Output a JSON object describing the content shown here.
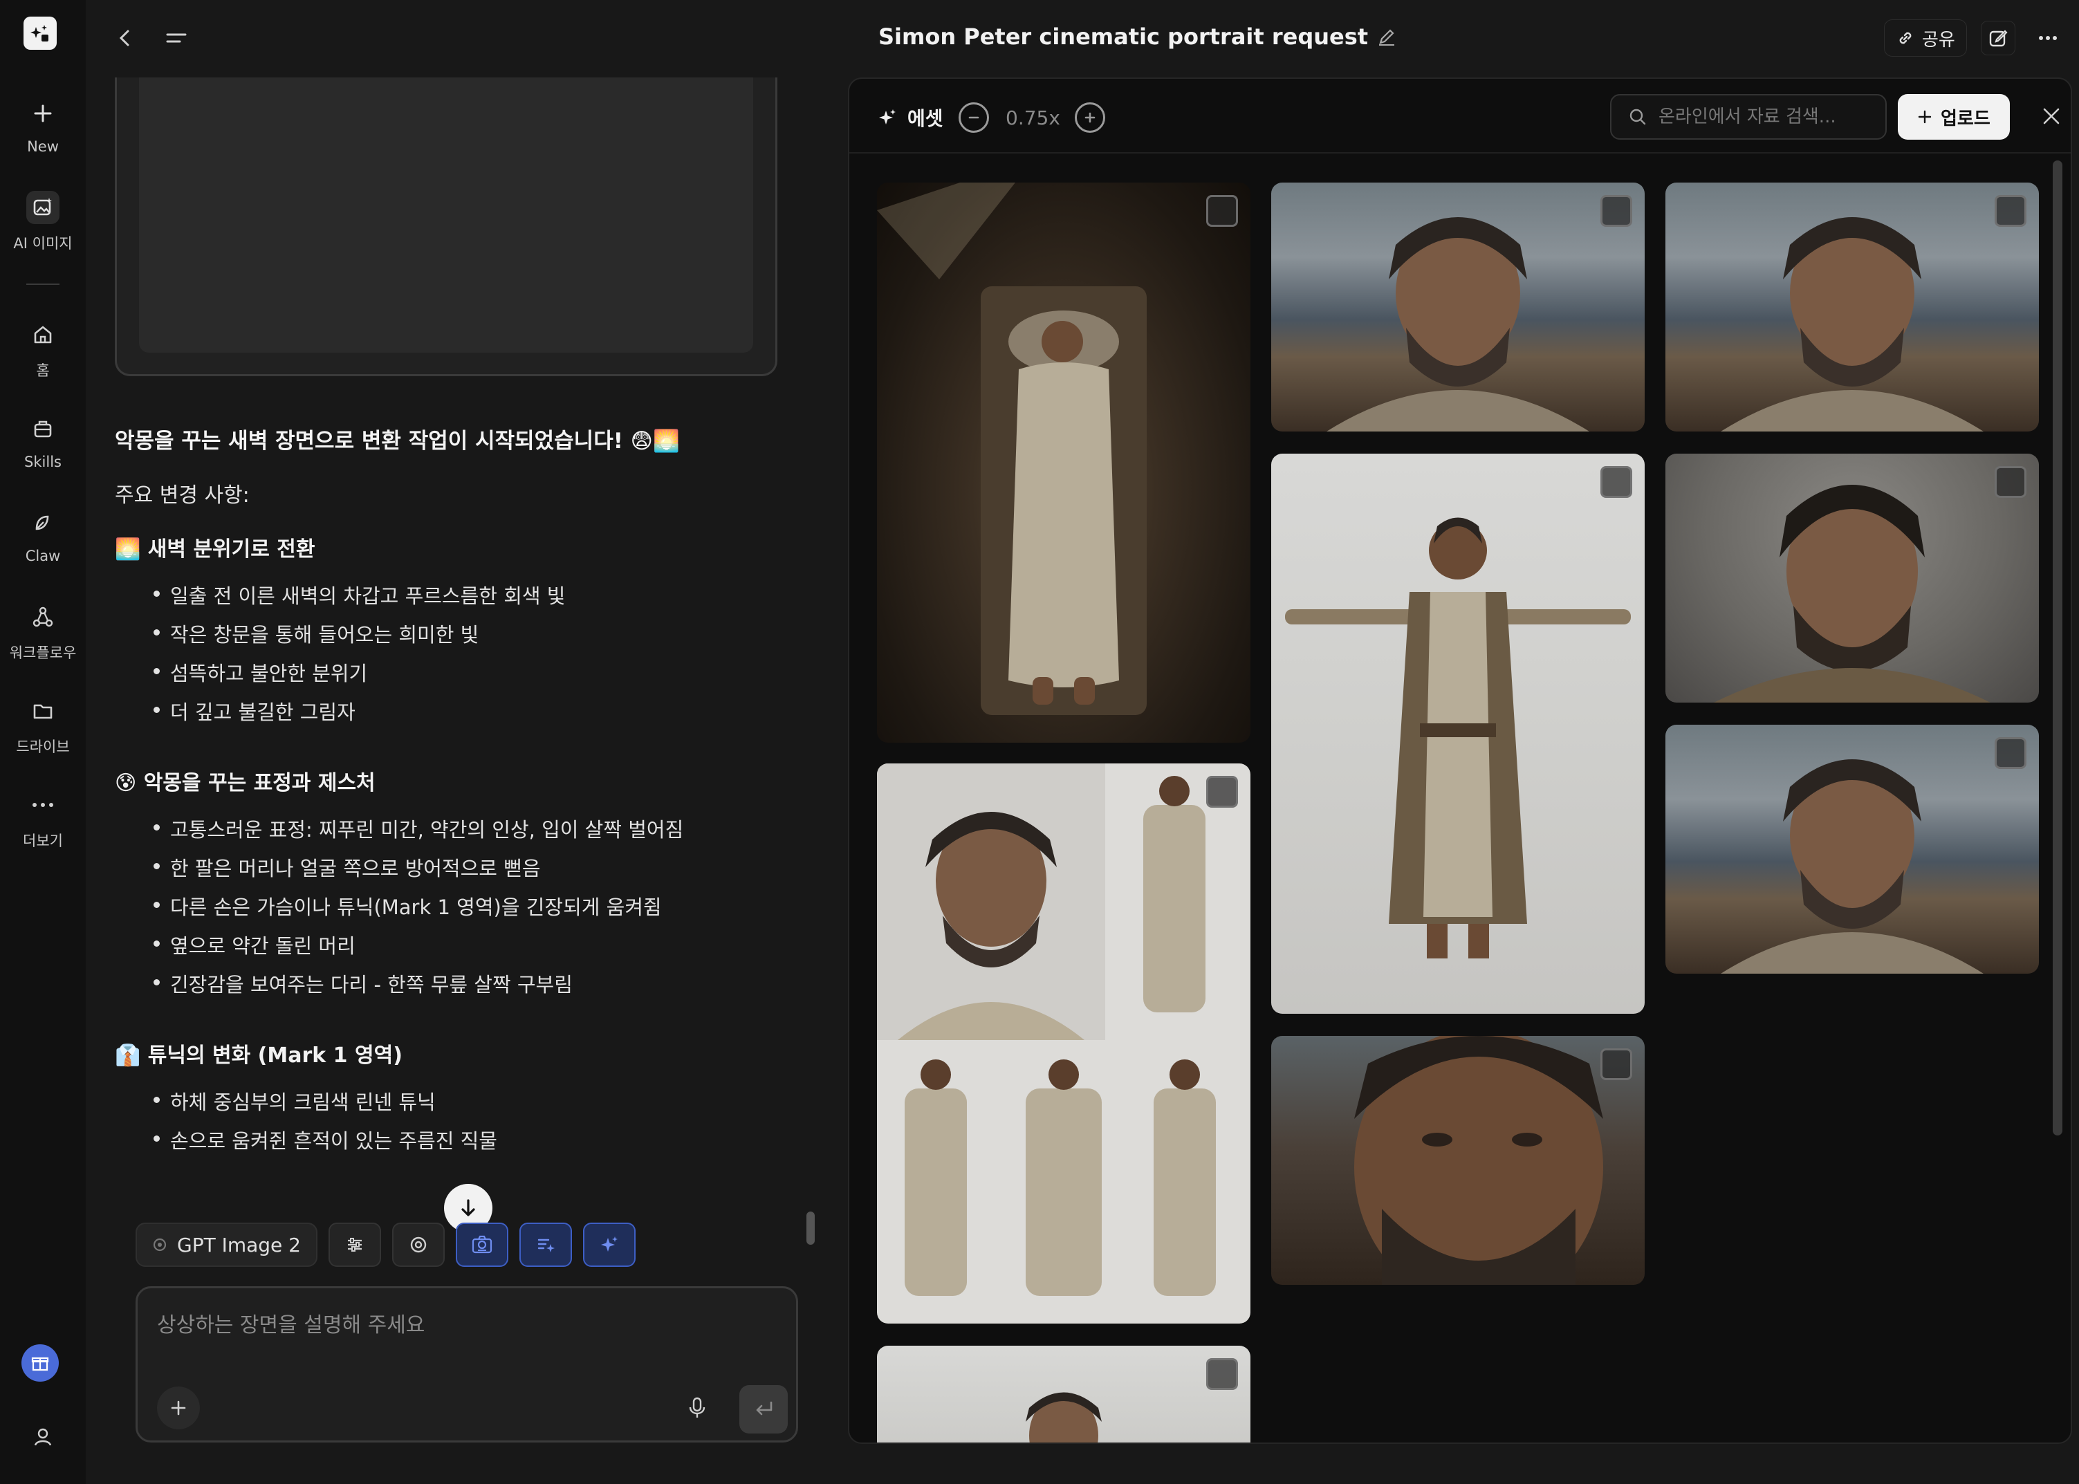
{
  "rail": {
    "items": [
      {
        "label": "New"
      },
      {
        "label": "AI 이미지"
      },
      {
        "label": "홈"
      },
      {
        "label": "Skills"
      },
      {
        "label": "Claw"
      },
      {
        "label": "워크플로우"
      },
      {
        "label": "드라이브"
      },
      {
        "label": "더보기"
      }
    ]
  },
  "header": {
    "title": "Simon Peter cinematic portrait request",
    "share_label": "공유"
  },
  "chat": {
    "headline": "악몽을 꾸는 새벽 장면으로 변환 작업이 시작되었습니다! 😨🌅",
    "intro": "주요 변경 사항:",
    "sections": [
      {
        "heading": "🌅 새벽 분위기로 전환",
        "items": [
          "일출 전 이른 새벽의 차갑고 푸르스름한 회색 빛",
          "작은 창문을 통해 들어오는 희미한 빛",
          "섬뜩하고 불안한 분위기",
          "더 깊고 불길한 그림자"
        ]
      },
      {
        "heading": "😰 악몽을 꾸는 표정과 제스처",
        "items": [
          "고통스러운 표정: 찌푸린 미간, 약간의 인상, 입이 살짝 벌어짐",
          "한 팔은 머리나 얼굴 쪽으로 방어적으로 뻗음",
          "다른 손은 가슴이나 튜닉(Mark 1 영역)을 긴장되게 움켜쥠",
          "옆으로 약간 돌린 머리",
          "긴장감을 보여주는 다리 - 한쪽 무릎 살짝 구부림"
        ]
      },
      {
        "heading": "👔 튜닉의 변화 (Mark 1 영역)",
        "items": [
          "하체 중심부의 크림색 린넨 튜닉",
          "손으로 움켜쥔 흔적이 있는 주름진 직물"
        ]
      }
    ]
  },
  "toolbar": {
    "model_label": "GPT Image 2"
  },
  "composer": {
    "placeholder": "상상하는 장면을 설명해 주세요"
  },
  "assets": {
    "title": "에셋",
    "zoom": "0.75x",
    "search_placeholder": "온라인에서 자료 검색...",
    "upload_label": "업로드"
  }
}
